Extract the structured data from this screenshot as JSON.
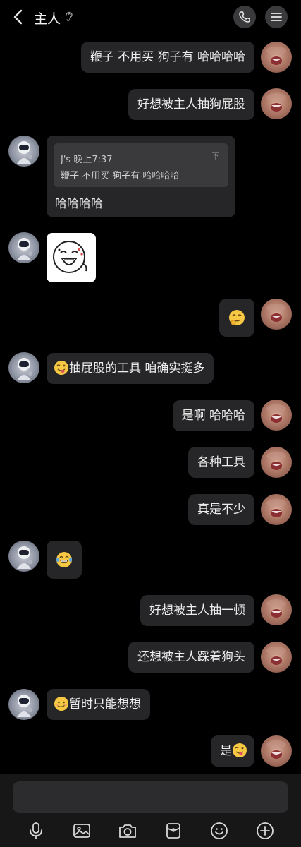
{
  "header": {
    "title": "主人",
    "icons": [
      "back-arrow-icon",
      "hearing-ear-icon",
      "phone-icon",
      "hamburger-menu-icon"
    ]
  },
  "messages": [
    {
      "side": "right",
      "text": "鞭子 不用买 狗子有 哈哈哈哈"
    },
    {
      "side": "right",
      "text": "好想被主人抽狗屁股"
    },
    {
      "side": "left",
      "type": "quote",
      "quote_author_time": "J's 晚上7:37",
      "quote_text": "鞭子 不用买 狗子有 哈哈哈哈",
      "text": "哈哈哈哈"
    },
    {
      "side": "left",
      "type": "sticker",
      "sticker": "laughing-face-sticker"
    },
    {
      "side": "right",
      "type": "emoji",
      "emoji": "smirking-face-emoji"
    },
    {
      "side": "left",
      "text": "抽屁股的工具 咱确实挺多",
      "emoji": "tongue-wink-emoji"
    },
    {
      "side": "right",
      "text": "是啊 哈哈哈"
    },
    {
      "side": "right",
      "text": "各种工具"
    },
    {
      "side": "right",
      "text": "真是不少"
    },
    {
      "side": "left",
      "type": "emoji",
      "emoji": "tears-of-joy-emoji"
    },
    {
      "side": "right",
      "text": "好想被主人抽一顿"
    },
    {
      "side": "right",
      "text": "还想被主人踩着狗头"
    },
    {
      "side": "left",
      "text": "暂时只能想想",
      "emoji": "grimace-smile-emoji"
    },
    {
      "side": "right",
      "text": "是",
      "emoji": "tongue-wink-emoji"
    }
  ],
  "toolbar": {
    "icons": [
      "microphone-icon",
      "image-icon",
      "camera-icon",
      "red-packet-icon",
      "emoji-icon",
      "plus-icon"
    ]
  },
  "colors": {
    "background": "#000000",
    "bubble": "#262628",
    "quote_box": "#3a3a3c",
    "text": "#ececec",
    "bottom_bar": "#171717"
  }
}
